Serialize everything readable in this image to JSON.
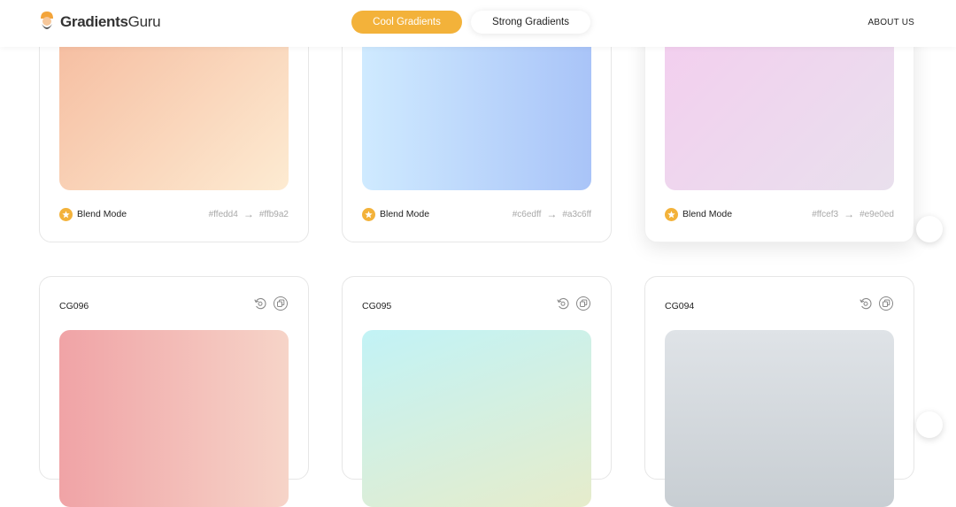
{
  "header": {
    "logo_bold": "Gradients",
    "logo_light": "Guru",
    "tabs": [
      {
        "label": "Cool Gradients",
        "active": true
      },
      {
        "label": "Strong Gradients",
        "active": false
      }
    ],
    "about_label": "ABOUT US"
  },
  "colors": {
    "accent": "#f3b23a"
  },
  "top_row": [
    {
      "blend_label": "Blend Mode",
      "from": "#ffedd4",
      "arrow": "→",
      "to": "#ffb9a2",
      "gradient": [
        "#f5b99c",
        "#fdebd2"
      ]
    },
    {
      "blend_label": "Blend Mode",
      "from": "#c6edff",
      "arrow": "→",
      "to": "#a3c6ff",
      "gradient": [
        "#cfeaff",
        "#a9c4f8"
      ]
    },
    {
      "blend_label": "Blend Mode",
      "from": "#ffcef3",
      "arrow": "→",
      "to": "#e9e0ed",
      "gradient": [
        "#f4cdef",
        "#e9e0ed"
      ]
    }
  ],
  "bottom_row": [
    {
      "name": "CG096",
      "gradient": [
        "#f0a3a6",
        "#f6d4c8"
      ]
    },
    {
      "name": "CG095",
      "gradient": [
        "#c2f3f6",
        "#e6eccb"
      ]
    },
    {
      "name": "CG094",
      "gradient": [
        "#dfe3e7",
        "#c8ced3"
      ]
    }
  ],
  "icons": {
    "logo": "guru-logo-icon",
    "star": "star-icon",
    "rotate": "rotate-icon",
    "copy": "copy-icon"
  }
}
